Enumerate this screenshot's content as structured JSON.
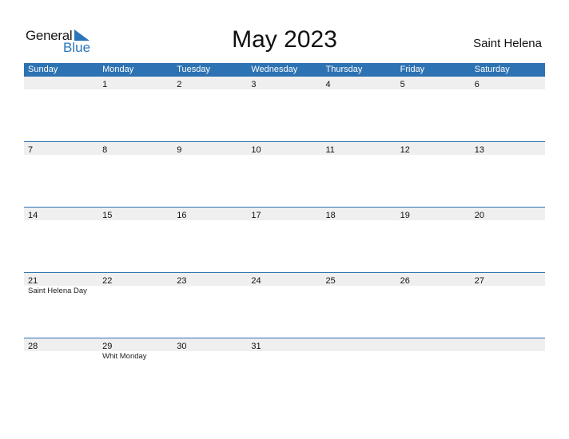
{
  "logo": {
    "general": "General",
    "blue": "Blue",
    "icon": "triangle-flag-icon",
    "color": "#2b75bb"
  },
  "title": "May 2023",
  "country": "Saint Helena",
  "header_color": "#2d72b2",
  "weekdays": [
    "Sunday",
    "Monday",
    "Tuesday",
    "Wednesday",
    "Thursday",
    "Friday",
    "Saturday"
  ],
  "weeks": [
    [
      {
        "day": ""
      },
      {
        "day": "1"
      },
      {
        "day": "2"
      },
      {
        "day": "3"
      },
      {
        "day": "4"
      },
      {
        "day": "5"
      },
      {
        "day": "6"
      }
    ],
    [
      {
        "day": "7"
      },
      {
        "day": "8"
      },
      {
        "day": "9"
      },
      {
        "day": "10"
      },
      {
        "day": "11"
      },
      {
        "day": "12"
      },
      {
        "day": "13"
      }
    ],
    [
      {
        "day": "14"
      },
      {
        "day": "15"
      },
      {
        "day": "16"
      },
      {
        "day": "17"
      },
      {
        "day": "18"
      },
      {
        "day": "19"
      },
      {
        "day": "20"
      }
    ],
    [
      {
        "day": "21",
        "holiday": "Saint Helena Day"
      },
      {
        "day": "22"
      },
      {
        "day": "23"
      },
      {
        "day": "24"
      },
      {
        "day": "25"
      },
      {
        "day": "26"
      },
      {
        "day": "27"
      }
    ],
    [
      {
        "day": "28"
      },
      {
        "day": "29",
        "holiday": "Whit Monday"
      },
      {
        "day": "30"
      },
      {
        "day": "31"
      },
      {
        "day": ""
      },
      {
        "day": ""
      },
      {
        "day": ""
      }
    ]
  ]
}
